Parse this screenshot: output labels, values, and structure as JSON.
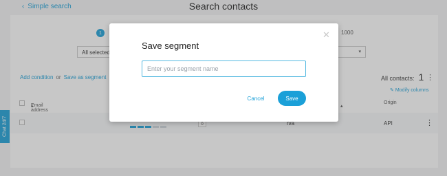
{
  "header": {
    "back_label": "Simple search",
    "title": "Search contacts"
  },
  "steps": {
    "current": "1",
    "right_value": "1000"
  },
  "filters": {
    "left_select_value": "All selected l"
  },
  "actions": {
    "add_condition": "Add condition",
    "or": "or",
    "save_as_segment": "Save as segment"
  },
  "summary": {
    "all_contacts_label": "All contacts:",
    "all_contacts_count": "1",
    "modify_columns": "Modify columns"
  },
  "table": {
    "columns": {
      "email": "Email address",
      "date": "",
      "origin": "Origin"
    },
    "rows": [
      {
        "badge": "0",
        "status": "n/a",
        "origin": "API"
      }
    ]
  },
  "chat_tab": "Chat 24/7",
  "modal": {
    "title": "Save segment",
    "input_value": "",
    "input_placeholder": "Enter your segment name",
    "cancel_label": "Cancel",
    "save_label": "Save"
  },
  "colors": {
    "accent": "#1ba0d8",
    "overlay": "rgba(80,80,80,0.32)"
  }
}
